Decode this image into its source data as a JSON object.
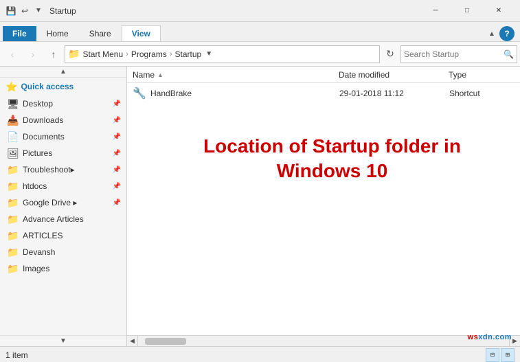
{
  "titleBar": {
    "title": "Startup",
    "icons": [
      "save-icon",
      "undo-icon"
    ],
    "controls": [
      "minimize",
      "maximize",
      "close"
    ]
  },
  "ribbon": {
    "tabs": [
      "File",
      "Home",
      "Share",
      "View"
    ],
    "activeTab": "View"
  },
  "addressBar": {
    "back": "‹",
    "forward": "›",
    "up": "↑",
    "pathIcon": "📁",
    "pathParts": [
      "Start Menu",
      "Programs",
      "Startup"
    ],
    "refreshIcon": "↻",
    "searchPlaceholder": "Search Startup",
    "searchIcon": "🔍"
  },
  "sidebar": {
    "quickAccessLabel": "Quick access",
    "items": [
      {
        "name": "Desktop",
        "icon": "🖥",
        "pinned": true
      },
      {
        "name": "Downloads",
        "icon": "📥",
        "pinned": true
      },
      {
        "name": "Documents",
        "icon": "📄",
        "pinned": true
      },
      {
        "name": "Pictures",
        "icon": "🖼",
        "pinned": true
      },
      {
        "name": "Troubleshoot▸",
        "icon": "📁",
        "pinned": true
      },
      {
        "name": "htdocs",
        "icon": "📁",
        "pinned": true
      },
      {
        "name": "Google Drive ▸",
        "icon": "📁",
        "pinned": true
      },
      {
        "name": "Advance Articles",
        "icon": "📁",
        "pinned": false
      },
      {
        "name": "ARTICLES",
        "icon": "📁",
        "pinned": false
      },
      {
        "name": "Devansh",
        "icon": "📁",
        "pinned": false
      },
      {
        "name": "Images",
        "icon": "📁",
        "pinned": false
      }
    ]
  },
  "columnHeaders": {
    "name": "Name",
    "sortArrow": "▲",
    "dateModified": "Date modified",
    "type": "Type"
  },
  "files": [
    {
      "name": "HandBrake",
      "icon": "🔧",
      "dateModified": "29-01-2018 11:12",
      "type": "Shortcut"
    }
  ],
  "overlayText": {
    "line1": "Location of Startup folder in",
    "line2": "Windows 10"
  },
  "statusBar": {
    "itemCount": "1 item"
  },
  "watermark": "wsxdn.com"
}
